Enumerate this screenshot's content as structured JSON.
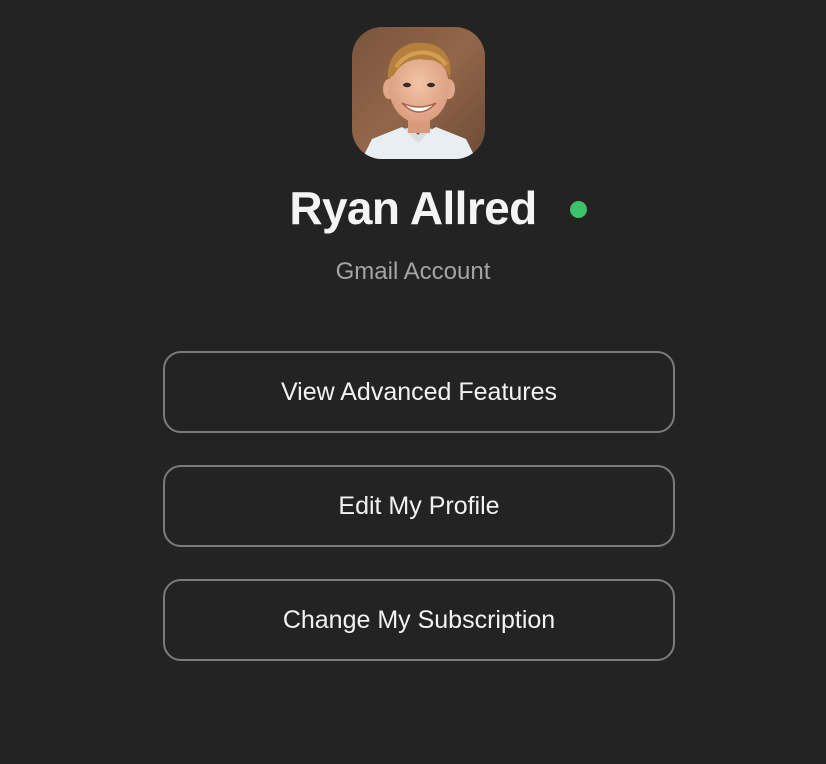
{
  "profile": {
    "name": "Ryan Allred",
    "account_type": "Gmail Account",
    "status": "online",
    "status_color": "#3cc26a",
    "avatar_icon": "user-photo"
  },
  "actions": [
    {
      "label": "View Advanced Features"
    },
    {
      "label": "Edit My Profile"
    },
    {
      "label": "Change My Subscription"
    }
  ]
}
